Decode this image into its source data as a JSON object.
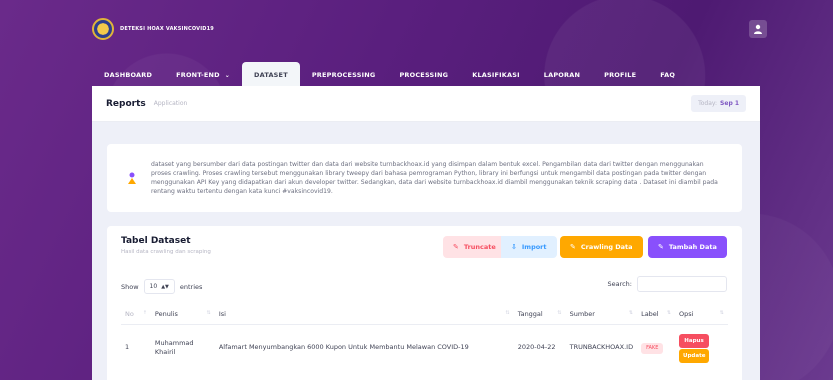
{
  "app": {
    "title": "DETEKSI HOAX VAKSINCOVID19"
  },
  "nav": [
    {
      "label": "DASHBOARD"
    },
    {
      "label": "FRONT-END"
    },
    {
      "label": "DATASET"
    },
    {
      "label": "PREPROCESSING"
    },
    {
      "label": "PROCESSING"
    },
    {
      "label": "KLASIFIKASI"
    },
    {
      "label": "LAPORAN"
    },
    {
      "label": "PROFILE"
    },
    {
      "label": "FAQ"
    }
  ],
  "subheader": {
    "title": "Reports",
    "desc": "Application",
    "today_label": "Today:",
    "today_value": "Sep 1"
  },
  "alert": {
    "text": "dataset yang bersumber dari data postingan twitter dan data dari website turnbackhoax.id yang disimpan dalam bentuk excel. Pengambilan data dari twitter dengan menggunakan proses crawling. Proses crawling tersebut menggunakan library tweepy dari bahasa pemrograman Python, library ini berfungsi untuk mengambil data postingan pada twitter dengan menggunakan API Key yang didapatkan dari akun developer twitter. Sedangkan, data dari website turnbackhoax.id diambil menggunakan teknik scraping data . Dataset ini diambil pada rentang waktu tertentu dengan kata kunci #vaksincovid19."
  },
  "card": {
    "title": "Tabel Dataset",
    "subtitle": "Hasil data crawling dan scraping",
    "buttons": {
      "truncate": "Truncate",
      "import": "Import",
      "crawling": "Crawling Data",
      "add": "Tambah Data"
    },
    "show_label": "Show",
    "entries_value": "10",
    "entries_label": "entries",
    "search_label": "Search:",
    "search_value": ""
  },
  "table": {
    "headers": [
      "No",
      "Penulis",
      "Isi",
      "Tanggal",
      "Sumber",
      "Label",
      "Opsi"
    ],
    "rows": [
      {
        "no": "1",
        "penulis": "Muhammad Khairil",
        "isi": "Alfamart Menyumbangkan 6000 Kupon Untuk Membantu Melawan COVID-19",
        "tanggal": "2020-04-22",
        "sumber": "TRUNBACKHOAX.ID",
        "label": "FAKE",
        "hapus": "Hapus",
        "update": "Update"
      }
    ]
  },
  "colors": {
    "accent": "#8950fc",
    "warning": "#ffa800",
    "danger": "#f64e60",
    "primary": "#3699ff"
  },
  "icons": {
    "user": "user-icon",
    "alert": "dataset-info-icon"
  }
}
